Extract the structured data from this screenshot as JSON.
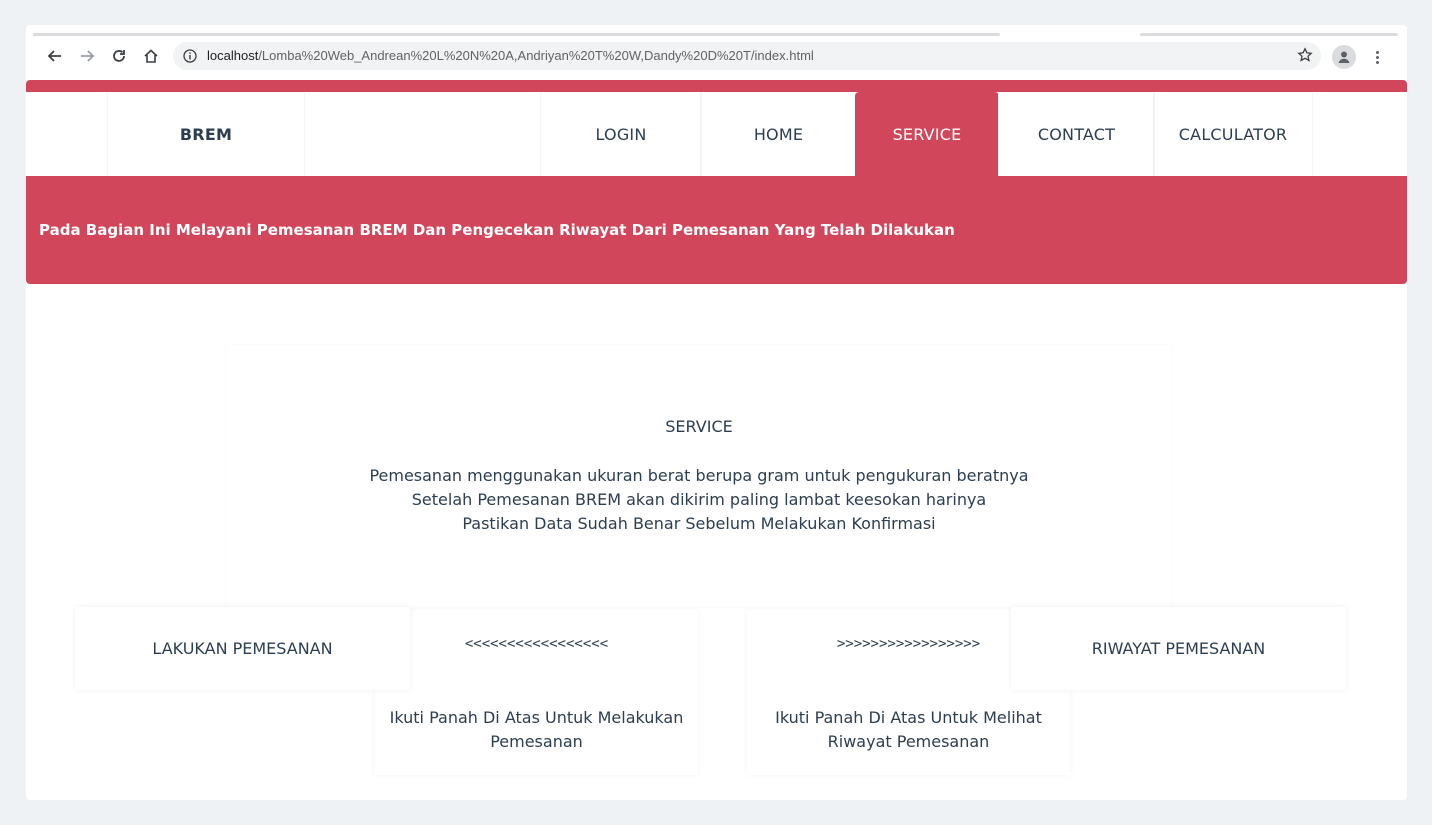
{
  "browser": {
    "url_host": "localhost",
    "url_path": "/Lomba%20Web_Andrean%20L%20N%20A,Andriyan%20T%20W,Dandy%20D%20T/index.html"
  },
  "nav": {
    "brand": "BREM",
    "items": [
      {
        "label": "LOGIN"
      },
      {
        "label": "HOME"
      },
      {
        "label": "SERVICE"
      },
      {
        "label": "CONTACT"
      },
      {
        "label": "CALCULATOR"
      }
    ],
    "active": "SERVICE"
  },
  "banner": {
    "text": "Pada Bagian Ini Melayani Pemesanan BREM Dan Pengecekan Riwayat Dari Pemesanan Yang Telah Dilakukan"
  },
  "service": {
    "title": "SERVICE",
    "lines": [
      "Pemesanan menggunakan ukuran berat berupa gram untuk pengukuran beratnya",
      "Setelah Pemesanan BREM akan dikirim paling lambat keesokan harinya",
      "Pastikan Data Sudah Benar Sebelum Melakukan Konfirmasi"
    ]
  },
  "actions": {
    "order_label": "LAKUKAN PEMESANAN",
    "history_label": "RIWAYAT PEMESANAN",
    "left_arrows": "<<<<<<<<<<<<<<<<<",
    "right_arrows": ">>>>>>>>>>>>>>>>>",
    "left_hint_1": "Ikuti Panah Di Atas Untuk Melakukan",
    "left_hint_2": "Pemesanan",
    "right_hint_1": "Ikuti Panah Di Atas Untuk Melihat",
    "right_hint_2": "Riwayat Pemesanan"
  },
  "colors": {
    "accent": "#d2465b",
    "text": "#2c3e50",
    "background": "#eef2f5"
  }
}
